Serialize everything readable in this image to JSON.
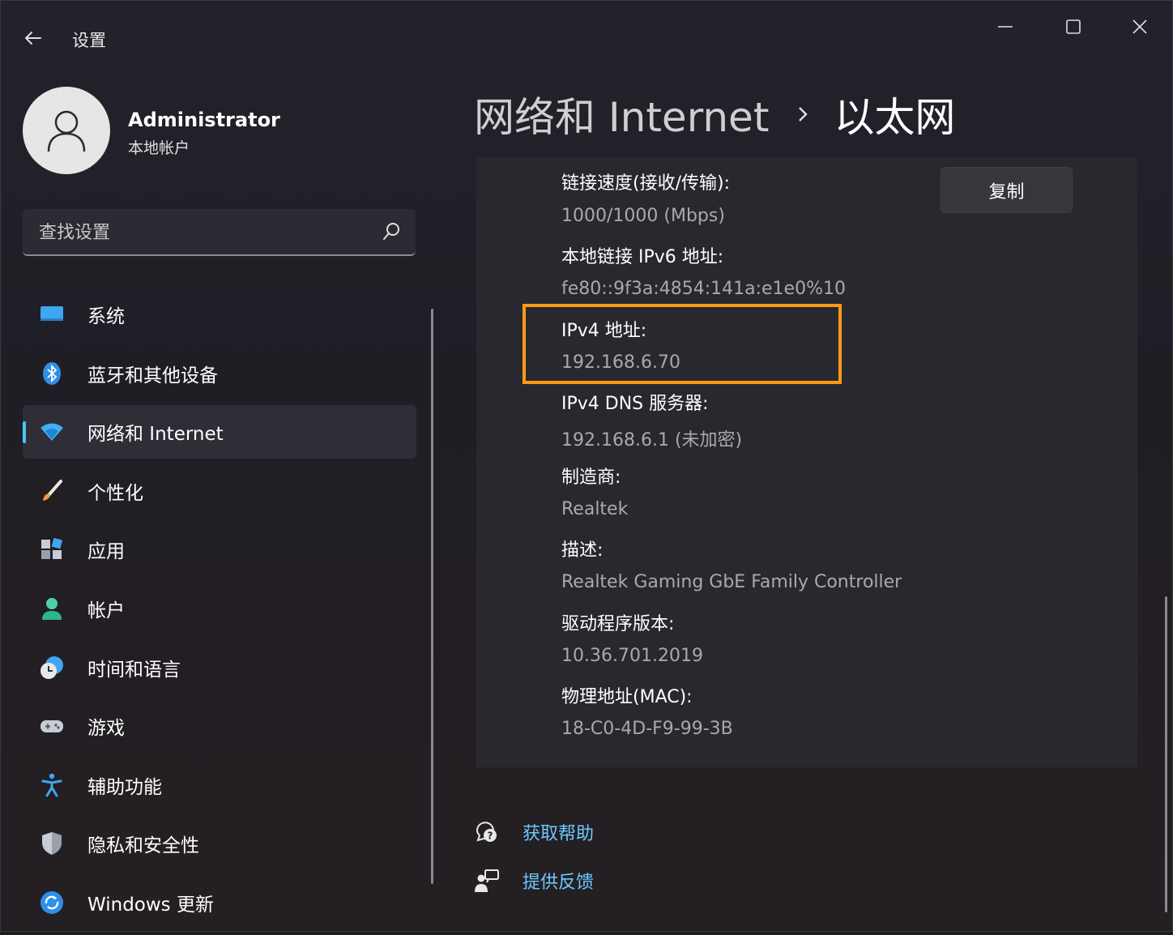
{
  "app": {
    "title": "设置"
  },
  "user": {
    "name": "Administrator",
    "type": "本地帐户"
  },
  "search": {
    "placeholder": "查找设置"
  },
  "nav": {
    "items": [
      {
        "label": "系统",
        "icon": "monitor-icon"
      },
      {
        "label": "蓝牙和其他设备",
        "icon": "bluetooth-icon"
      },
      {
        "label": "网络和 Internet",
        "icon": "wifi-icon",
        "active": true
      },
      {
        "label": "个性化",
        "icon": "brush-icon"
      },
      {
        "label": "应用",
        "icon": "apps-icon"
      },
      {
        "label": "帐户",
        "icon": "person-icon"
      },
      {
        "label": "时间和语言",
        "icon": "clock-globe-icon"
      },
      {
        "label": "游戏",
        "icon": "gamepad-icon"
      },
      {
        "label": "辅助功能",
        "icon": "accessibility-icon"
      },
      {
        "label": "隐私和安全性",
        "icon": "shield-icon"
      },
      {
        "label": "Windows 更新",
        "icon": "update-icon"
      }
    ]
  },
  "breadcrumb": {
    "parent": "网络和 Internet",
    "current": "以太网"
  },
  "details": {
    "copy_label": "复制",
    "fields": [
      {
        "label": "链接速度(接收/传输):",
        "value": "1000/1000 (Mbps)"
      },
      {
        "label": "本地链接 IPv6 地址:",
        "value": "fe80::9f3a:4854:141a:e1e0%10"
      },
      {
        "label": "IPv4 地址:",
        "value": "192.168.6.70",
        "highlighted": true
      },
      {
        "label": "IPv4 DNS 服务器:",
        "value": "192.168.6.1 (未加密)"
      },
      {
        "label": "制造商:",
        "value": "Realtek"
      },
      {
        "label": "描述:",
        "value": "Realtek Gaming GbE Family Controller"
      },
      {
        "label": "驱动程序版本:",
        "value": "10.36.701.2019"
      },
      {
        "label": "物理地址(MAC):",
        "value": "18-C0-4D-F9-99-3B"
      }
    ]
  },
  "footer": {
    "help_label": "获取帮助",
    "feedback_label": "提供反馈"
  },
  "colors": {
    "accent": "#4cc2ff",
    "link": "#6cc8ff",
    "highlight": "#ff9a14"
  }
}
